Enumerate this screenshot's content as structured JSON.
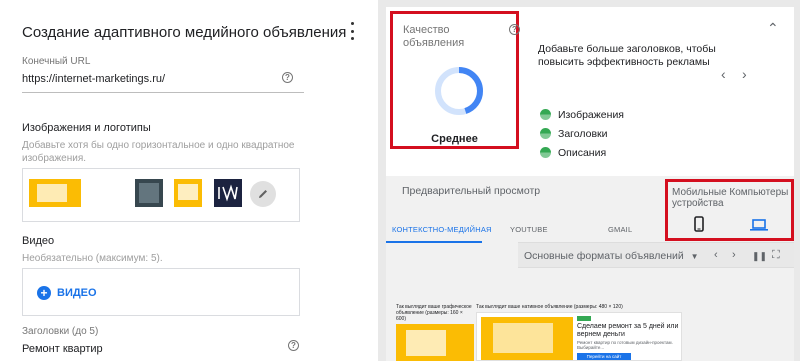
{
  "editor": {
    "title": "Создание адаптивного медийного объявления",
    "final_url_label": "Конечный URL",
    "final_url_value": "https://internet-marketings.ru/",
    "images_title": "Изображения и логотипы",
    "images_hint": "Добавьте хотя бы одно горизонтальное и одно квадратное изображения.",
    "video_title": "Видео",
    "video_hint": "Необязательно (максимум: 5).",
    "add_video_label": "ВИДЕО",
    "headlines_label": "Заголовки (до 5)",
    "headline_value": "Ремонт квартир"
  },
  "quality": {
    "title": "Качество объявления",
    "level": "Среднее",
    "score_fraction": 0.45,
    "suggestion": "Добавьте больше заголовков, чтобы повысить эффективность рекламы",
    "checks": [
      "Изображения",
      "Заголовки",
      "Описания"
    ]
  },
  "preview": {
    "title": "Предварительный просмотр",
    "devices_label": "Мобильные Компьютеры устройства",
    "tabs": [
      "КОНТЕКСТНО-МЕДИЙНАЯ",
      "YOUTUBE",
      "GMAIL"
    ],
    "format_select": "Основные форматы объявлений",
    "ad1_caption": "Так выглядит ваше графическое объявление (размеры: 160 × 600)",
    "ad2_caption": "Так выглядит ваше нативное объявление (размеры: 480 × 120)",
    "ad2_headline": "Сделаем ремонт за 5 дней или вернем деньги",
    "ad2_body": "Ремонт квартир по готовым дизайн-проектам. Выбирайте...",
    "ad2_button": "Перейти на сайт"
  },
  "colors": {
    "accent": "#1a73e8",
    "highlight": "#d40f1f",
    "good": "#34a853"
  }
}
